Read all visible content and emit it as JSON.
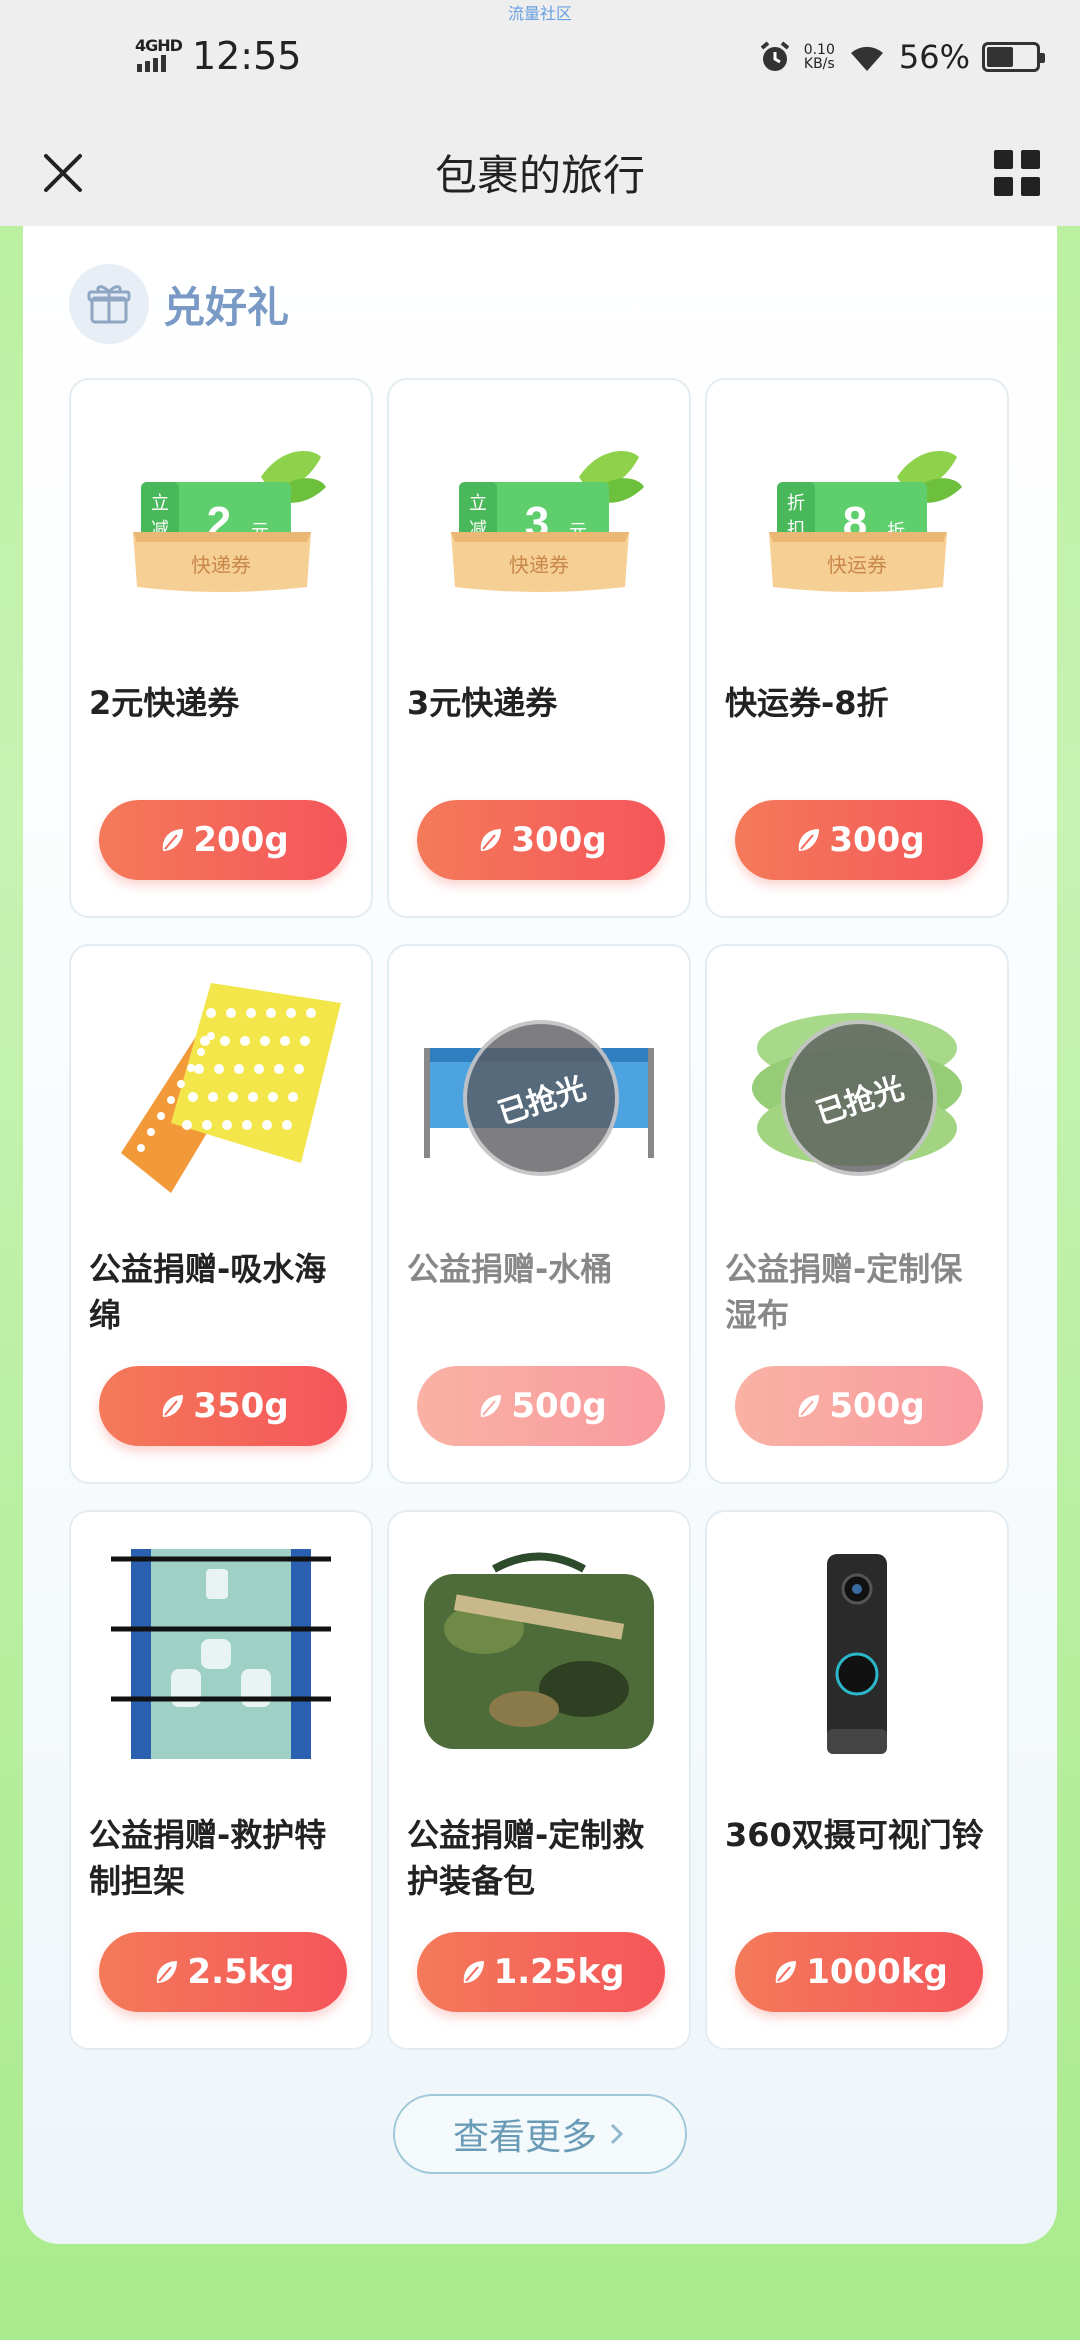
{
  "status_bar": {
    "top_label": "流量社区",
    "network": "4GHD",
    "time": "12:55",
    "speed_value": "0.10",
    "speed_unit": "KB/s",
    "battery": "56%"
  },
  "nav": {
    "title": "包裹的旅行",
    "close_icon": "close-icon",
    "menu_icon": "grid-icon"
  },
  "section": {
    "title": "兑好礼",
    "icon": "gift-icon"
  },
  "items": [
    {
      "name": "2元快递券",
      "price": "200g",
      "sold_out": false,
      "thumb": "coupon",
      "coupon": {
        "left1": "立",
        "left2": "减",
        "big": "2",
        "unit": "元",
        "label": "快递券"
      }
    },
    {
      "name": "3元快递券",
      "price": "300g",
      "sold_out": false,
      "thumb": "coupon",
      "coupon": {
        "left1": "立",
        "left2": "减",
        "big": "3",
        "unit": "元",
        "label": "快递券"
      }
    },
    {
      "name": "快运券-8折",
      "price": "300g",
      "sold_out": false,
      "thumb": "coupon",
      "coupon": {
        "left1": "折",
        "left2": "扣",
        "big": "8",
        "unit": "折",
        "label": "快运券"
      }
    },
    {
      "name": "公益捐赠-吸水海绵",
      "price": "350g",
      "sold_out": false,
      "thumb": "sponge"
    },
    {
      "name": "公益捐赠-水桶",
      "price": "500g",
      "sold_out": true,
      "thumb": "pool"
    },
    {
      "name": "公益捐赠-定制保湿布",
      "price": "500g",
      "sold_out": true,
      "thumb": "cloth"
    },
    {
      "name": "公益捐赠-救护特制担架",
      "price": "2.5kg",
      "sold_out": false,
      "thumb": "stretcher"
    },
    {
      "name": "公益捐赠-定制救护装备包",
      "price": "1.25kg",
      "sold_out": false,
      "thumb": "bag"
    },
    {
      "name": "360双摄可视门铃",
      "price": "1000kg",
      "sold_out": false,
      "thumb": "doorbell"
    }
  ],
  "sold_out_stamp": "已抢光",
  "more_button": "查看更多",
  "colors": {
    "accent_red": "#f5555a",
    "section_title": "#7a9ac6",
    "background_green": "#b6ef9a"
  }
}
